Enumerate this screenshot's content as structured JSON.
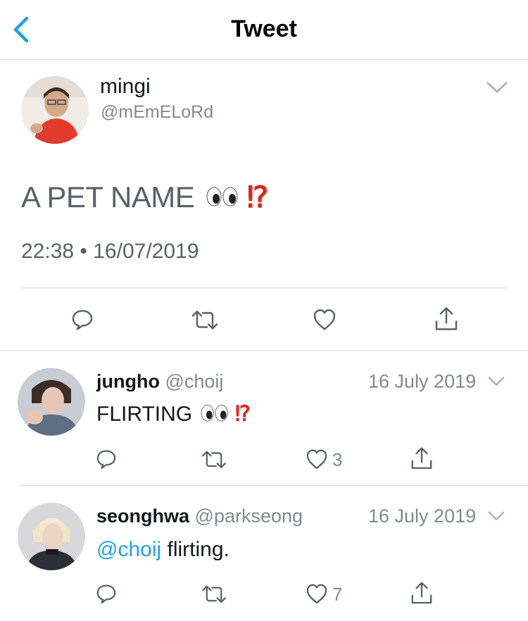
{
  "nav": {
    "title": "Tweet"
  },
  "main_tweet": {
    "name": "mingi",
    "handle": "@mEmELoRd",
    "text": "A PET NAME",
    "emoji_eyes": "eyes",
    "emoji_mark": "⁉",
    "time": "22:38 • 16/07/2019"
  },
  "replies": [
    {
      "name": "jungho",
      "handle": "@choij",
      "date": "16 July 2019",
      "text": "FLIRTING",
      "emoji_mark": "⁉",
      "likes": "3"
    },
    {
      "name": "seonghwa",
      "handle": "@parkseong",
      "date": "16 July 2019",
      "mention": "@choij",
      "text": " flirting.",
      "likes": "7"
    }
  ],
  "colors": {
    "accent": "#1da1f2",
    "muted": "#7f8a94",
    "divider": "#d6d9dc",
    "alert": "#e0261b"
  },
  "icons": [
    "back-chevron-icon",
    "chevron-down-icon",
    "reply-icon",
    "retweet-icon",
    "like-icon",
    "share-icon",
    "eyes-emoji",
    "exclamation-question-emoji"
  ]
}
